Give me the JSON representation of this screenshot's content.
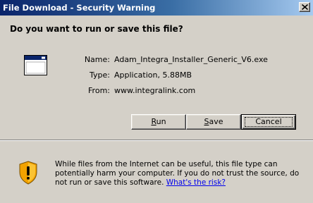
{
  "title": "File Download - Security Warning",
  "question": "Do you want to run or save this file?",
  "file": {
    "name_label": "Name:",
    "name_value": "Adam_Integra_Installer_Generic_V6.exe",
    "type_label": "Type:",
    "type_value": "Application, 5.88MB",
    "from_label": "From:",
    "from_value": "www.integralink.com"
  },
  "buttons": {
    "run": {
      "mnemonic": "R",
      "rest": "un"
    },
    "save": {
      "mnemonic": "S",
      "rest": "ave"
    },
    "cancel": "Cancel"
  },
  "warning": {
    "text": "While files from the Internet can be useful, this file type can potentially harm your computer. If you do not trust the source, do not run or save this software. ",
    "link": "What's the risk?"
  },
  "icons": {
    "file": "application-window-icon",
    "warning": "security-shield-warning-icon",
    "close": "close-icon"
  },
  "colors": {
    "titlebar_start": "#0a246a",
    "titlebar_end": "#a6caf0",
    "dialog_bg": "#d4d0c8",
    "link": "#0000ee",
    "shield": "#f2a200"
  }
}
